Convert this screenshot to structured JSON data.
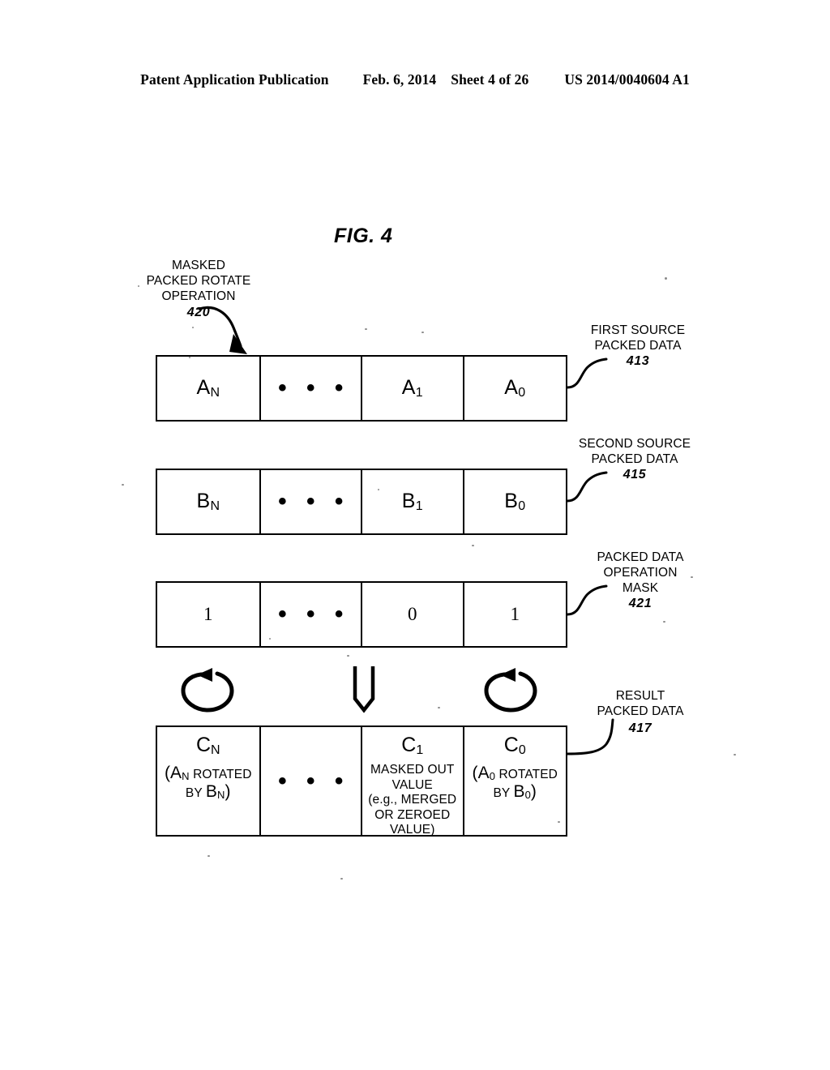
{
  "header": {
    "publication": "Patent Application Publication",
    "date": "Feb. 6, 2014",
    "sheet": "Sheet 4 of 26",
    "docnum": "US 2014/0040604 A1"
  },
  "figure": {
    "title": "FIG. 4",
    "operation_label": {
      "line1": "MASKED",
      "line2": "PACKED ROTATE",
      "line3": "OPERATION",
      "ref": "420"
    }
  },
  "rows": {
    "first_source": {
      "cells": [
        "A",
        "• • •",
        "A",
        "A"
      ],
      "cell_sub": [
        "N",
        "",
        "1",
        "0"
      ],
      "callout": {
        "line1": "FIRST SOURCE",
        "line2": "PACKED DATA",
        "ref": "413"
      }
    },
    "second_source": {
      "cells": [
        "B",
        "• • •",
        "B",
        "B"
      ],
      "cell_sub": [
        "N",
        "",
        "1",
        "0"
      ],
      "callout": {
        "line1": "SECOND SOURCE",
        "line2": "PACKED DATA",
        "ref": "415"
      }
    },
    "mask": {
      "cells": [
        "1",
        "• • •",
        "0",
        "1"
      ],
      "callout": {
        "line1": "PACKED DATA",
        "line2": "OPERATION",
        "line3": "MASK",
        "ref": "421"
      }
    },
    "result": {
      "cell_n": {
        "main": "C",
        "main_sub": "N",
        "detail_open": "(A",
        "detail_open_sub": "N",
        "detail_mid": " ROTATED",
        "detail_line2_pre": "BY ",
        "detail_line2_big": "B",
        "detail_line2_sub": "N",
        "detail_line2_post": ")"
      },
      "cell_dots": "• • •",
      "cell_1": {
        "main": "C",
        "main_sub": "1",
        "note1": "MASKED OUT",
        "note2": "VALUE",
        "note3": "(e.g., MERGED",
        "note4": "OR ZEROED",
        "note5": "VALUE)"
      },
      "cell_0": {
        "main": "C",
        "main_sub": "0",
        "detail_open": "(A",
        "detail_open_sub": "0",
        "detail_mid": " ROTATED",
        "detail_line2_pre": "BY ",
        "detail_line2_big": "B",
        "detail_line2_sub": "0",
        "detail_line2_post": ")"
      },
      "callout": {
        "line1": "RESULT",
        "line2": "PACKED DATA",
        "ref": "417"
      }
    }
  },
  "glyphs": {
    "rotate_left": "rotate-arrow-icon",
    "rotate_right": "rotate-arrow-icon",
    "down": "double-down-arrow-icon",
    "pointer_420": "curved-pointer-arrow-icon"
  },
  "colors": {
    "ink": "#000000",
    "paper": "#ffffff"
  }
}
